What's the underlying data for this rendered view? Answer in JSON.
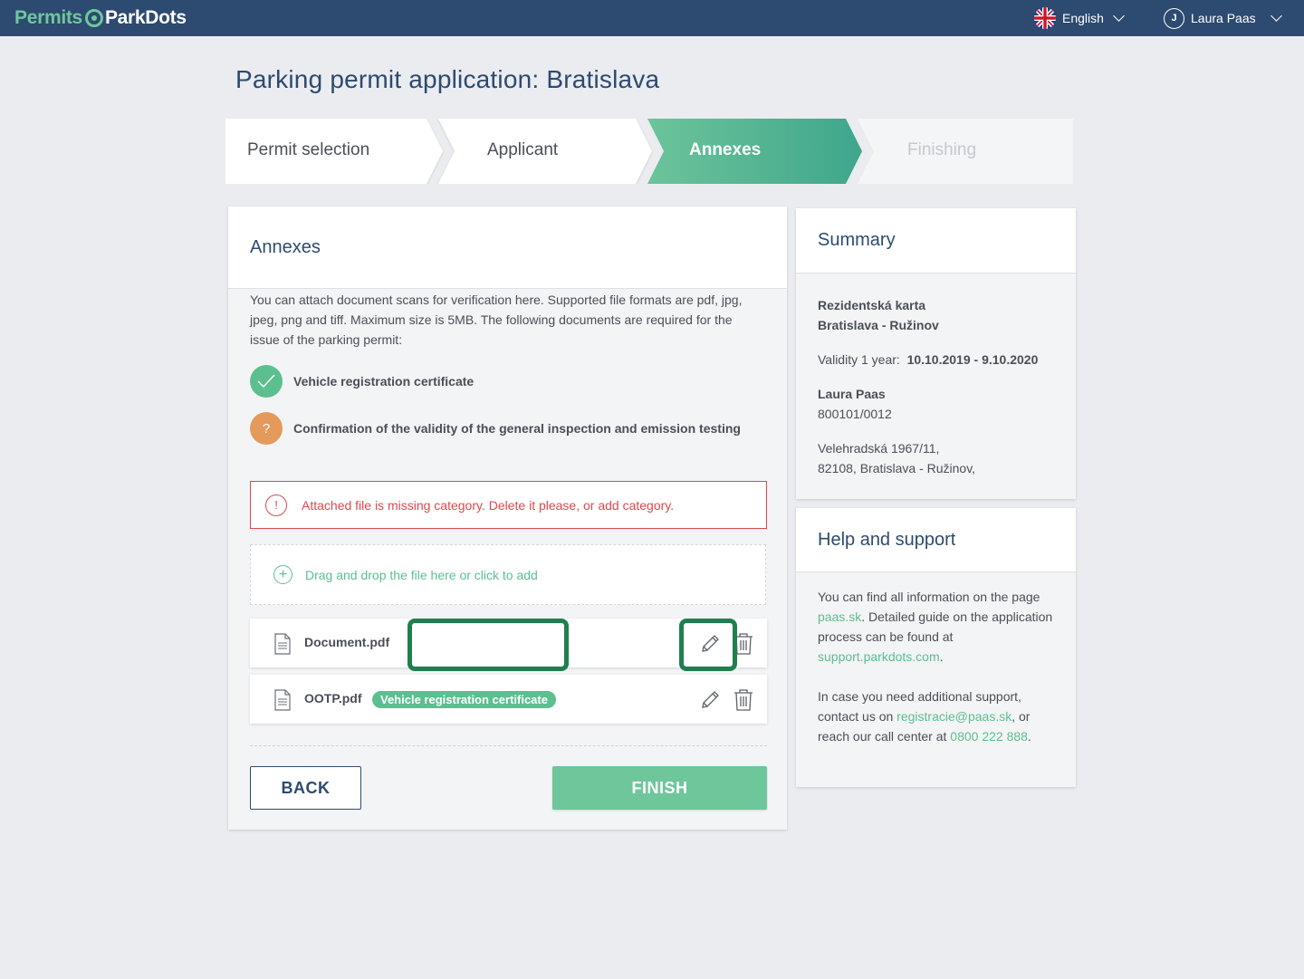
{
  "header": {
    "logo_part1": "Permits",
    "logo_part2": "ParkDots",
    "language": "English",
    "user_initial": "J",
    "user_name": "Laura Paas"
  },
  "page_title": "Parking permit application: Bratislava",
  "steps": [
    {
      "label": "Permit selection",
      "state": "done"
    },
    {
      "label": "Applicant",
      "state": "done"
    },
    {
      "label": "Annexes",
      "state": "active"
    },
    {
      "label": "Finishing",
      "state": "upcoming"
    }
  ],
  "annexes": {
    "title": "Annexes",
    "intro": "You can attach document scans for verification here. Supported file formats are pdf, jpg, jpeg, png and tiff. Maximum size is 5MB. The following documents are required for the issue of the parking permit:",
    "requirements": [
      {
        "label": "Vehicle registration certificate",
        "status": "ok",
        "icon": "check-icon"
      },
      {
        "label": "Confirmation of the validity of the general inspection and emission testing",
        "status": "missing",
        "icon": "question-icon",
        "icon_text": "?"
      }
    ],
    "error_icon_text": "!",
    "error_message": "Attached file is missing category. Delete it please, or add category.",
    "drop_text": "Drag and drop the file here or click to add",
    "files": [
      {
        "name": "Document.pdf",
        "category": ""
      },
      {
        "name": "OOTP.pdf",
        "category": "Vehicle registration certificate"
      }
    ],
    "back_label": "BACK",
    "finish_label": "FINISH"
  },
  "summary": {
    "title": "Summary",
    "permit_type": "Rezidentská karta",
    "zone": "Bratislava - Ružinov",
    "validity_label": "Validity 1 year:",
    "validity_value": "10.10.2019 - 9.10.2020",
    "person_name": "Laura Paas",
    "person_id": "800101/0012",
    "address_line1": "Velehradská 1967/11,",
    "address_line2": "82108, Bratislava - Ružinov,"
  },
  "help": {
    "title": "Help and support",
    "p1_a": "You can find all information on the page ",
    "p1_link1": "paas.sk",
    "p1_b": ". Detailed guide on the application process can be found at ",
    "p1_link2": "support.parkdots.com",
    "p1_c": ".",
    "p2_a": "In case you need additional support, contact us on ",
    "p2_link1": "registracie@paas.sk",
    "p2_b": ", or reach our call center at ",
    "p2_link2": "0800 222 888",
    "p2_c": "."
  },
  "colors": {
    "header_bg": "#2d4a70",
    "accent_green": "#5bbf90",
    "active_step": "#4fb38e",
    "error_red": "#e0474c",
    "warning_orange": "#e39a5b",
    "highlight_green": "#1f7f4f"
  }
}
